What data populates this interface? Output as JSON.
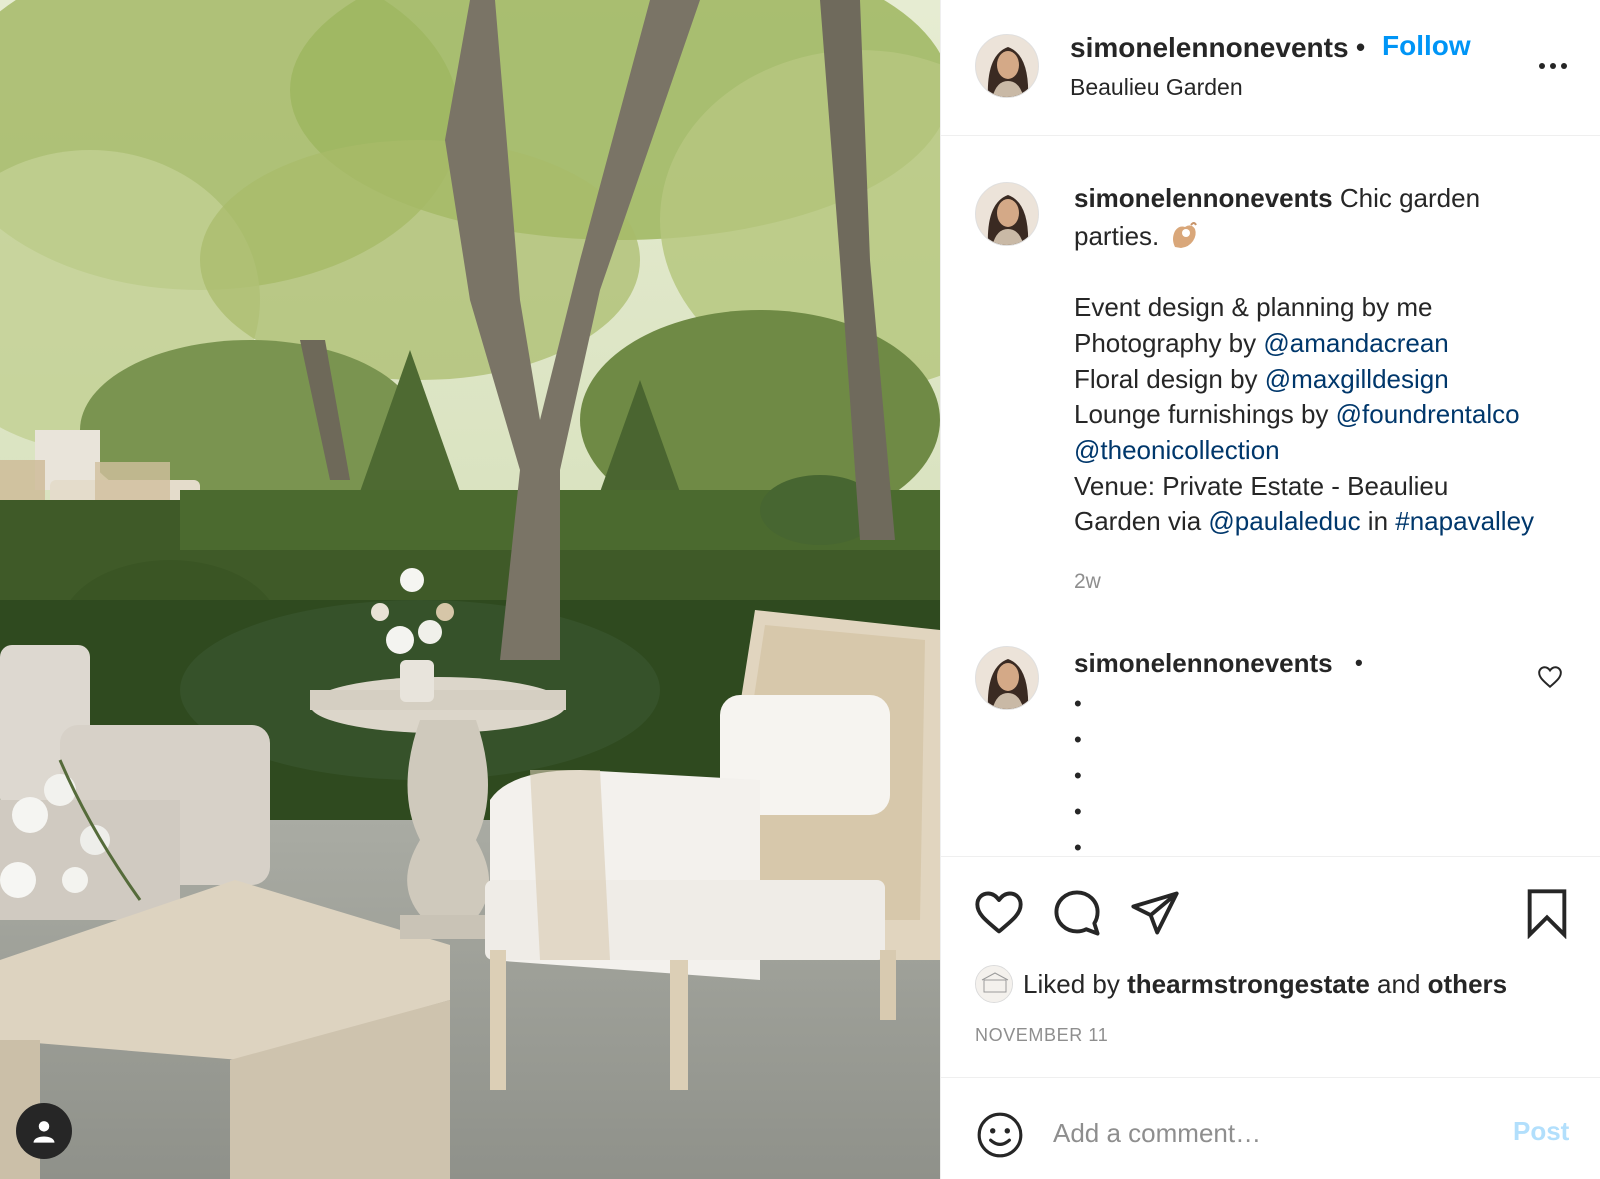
{
  "post": {
    "username": "simonelennonevents",
    "follow_label": "Follow",
    "separator": "•",
    "location": "Beaulieu Garden",
    "more_icon": "more-options-icon"
  },
  "caption": {
    "username": "simonelennonevents",
    "first_text": "Chic garden",
    "second_text": "parties.",
    "emoji": "ok-hand-emoji",
    "l3": "Event design & planning by me",
    "l4_text": "Photography by ",
    "l4_link": "@amandacrean",
    "l5_text": "Floral design by ",
    "l5_link": "@maxgilldesign",
    "l6_text": "Lounge furnishings by ",
    "l6_link": "@foundrentalco",
    "l7_link": "@theonicollection",
    "l8": "Venue: Private Estate - Beaulieu",
    "l9_text": "Garden via ",
    "l9_link": "@paulaleduc",
    "l9_mid": " in ",
    "l9_hashtag": "#napavalley",
    "time_ago": "2w"
  },
  "comment": {
    "username": "simonelennonevents",
    "separator": "•",
    "bullets": [
      "•",
      "•",
      "•",
      "•",
      "•"
    ]
  },
  "actions": {
    "like_icon": "heart-icon",
    "comment_icon": "comment-icon",
    "share_icon": "paper-plane-icon",
    "save_icon": "bookmark-icon",
    "liked_by_prefix": "Liked by ",
    "liked_by_user": "thearmstrongestate",
    "liked_by_and": " and ",
    "liked_by_others": "others",
    "date": "NOVEMBER 11"
  },
  "comment_box": {
    "placeholder": "Add a comment…",
    "post_label": "Post",
    "emoji_icon": "smiley-icon"
  },
  "colors": {
    "link": "#00376b",
    "follow": "#0095f6",
    "post_disabled": "#b2dffc",
    "muted": "#8e8e8e"
  }
}
